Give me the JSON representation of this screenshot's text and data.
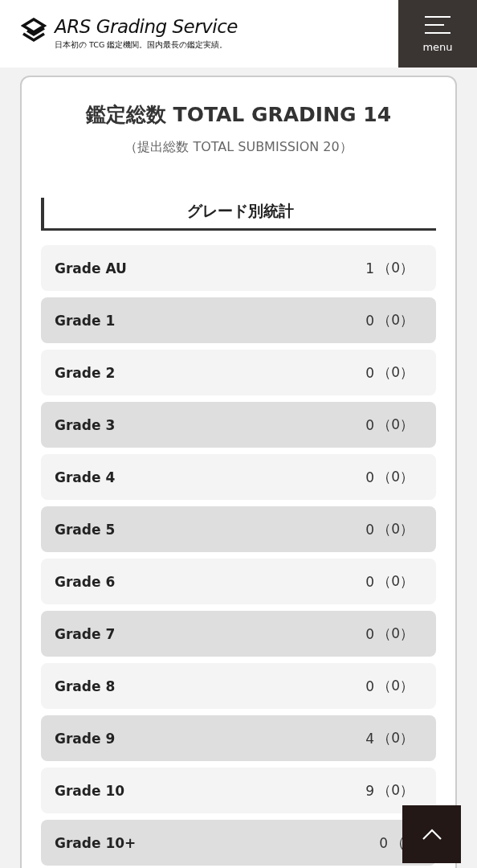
{
  "header": {
    "brand": "ARS Grading Service",
    "tagline": "日本初の TCG 鑑定機関。国内最長の鑑定実績。",
    "menu_label": "menu"
  },
  "summary": {
    "title": "鑑定総数 TOTAL GRADING 14",
    "subtitle": "（提出総数 TOTAL SUBMISSION 20）"
  },
  "section": {
    "heading": "グレード別統計"
  },
  "grades": [
    {
      "label": "Grade AU",
      "count": "1",
      "sub": "（0）"
    },
    {
      "label": "Grade 1",
      "count": "0",
      "sub": "（0）"
    },
    {
      "label": "Grade 2",
      "count": "0",
      "sub": "（0）"
    },
    {
      "label": "Grade 3",
      "count": "0",
      "sub": "（0）"
    },
    {
      "label": "Grade 4",
      "count": "0",
      "sub": "（0）"
    },
    {
      "label": "Grade 5",
      "count": "0",
      "sub": "（0）"
    },
    {
      "label": "Grade 6",
      "count": "0",
      "sub": "（0）"
    },
    {
      "label": "Grade 7",
      "count": "0",
      "sub": "（0）"
    },
    {
      "label": "Grade 8",
      "count": "0",
      "sub": "（0）"
    },
    {
      "label": "Grade 9",
      "count": "4",
      "sub": "（0）"
    },
    {
      "label": "Grade 10",
      "count": "9",
      "sub": "（0）"
    },
    {
      "label": "Grade 10+",
      "count": "0",
      "sub": "（"
    }
  ]
}
